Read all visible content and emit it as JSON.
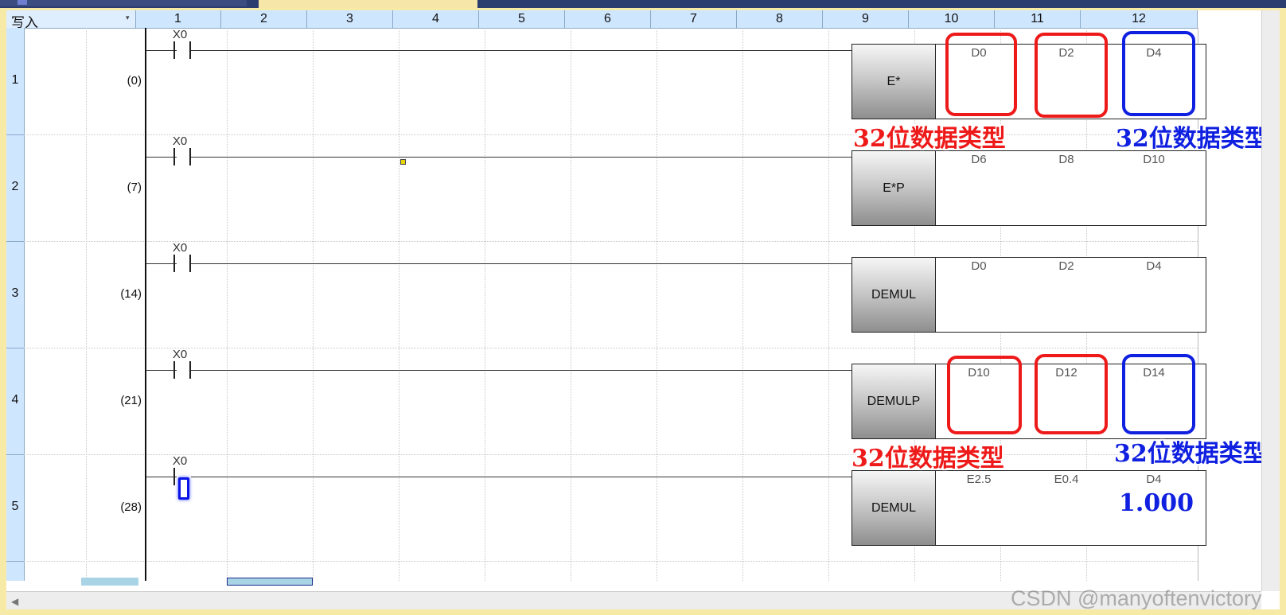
{
  "toolbar": {
    "mode": "写入"
  },
  "columns": [
    "1",
    "2",
    "3",
    "4",
    "5",
    "6",
    "7",
    "8",
    "9",
    "10",
    "11",
    "12"
  ],
  "rows": [
    {
      "num": "1",
      "step": "(0)",
      "contact": "X0",
      "instruction": "E*",
      "operands": [
        "D0",
        "D2",
        "D4"
      ]
    },
    {
      "num": "2",
      "step": "(7)",
      "contact": "X0",
      "instruction": "E*P",
      "operands": [
        "D6",
        "D8",
        "D10"
      ]
    },
    {
      "num": "3",
      "step": "(14)",
      "contact": "X0",
      "instruction": "DEMUL",
      "operands": [
        "D0",
        "D2",
        "D4"
      ]
    },
    {
      "num": "4",
      "step": "(21)",
      "contact": "X0",
      "instruction": "DEMULP",
      "operands": [
        "D10",
        "D12",
        "D14"
      ]
    },
    {
      "num": "5",
      "step": "(28)",
      "contact": "X0",
      "instruction": "DEMUL",
      "operands": [
        "E2.5",
        "E0.4",
        "D4"
      ]
    }
  ],
  "annotations": {
    "label_32bit": "32位数据类型",
    "result_value": "1.000",
    "red_color": "#ee1a1a",
    "blue_color": "#1020e0"
  },
  "watermark": "CSDN @manyoftenvictory"
}
